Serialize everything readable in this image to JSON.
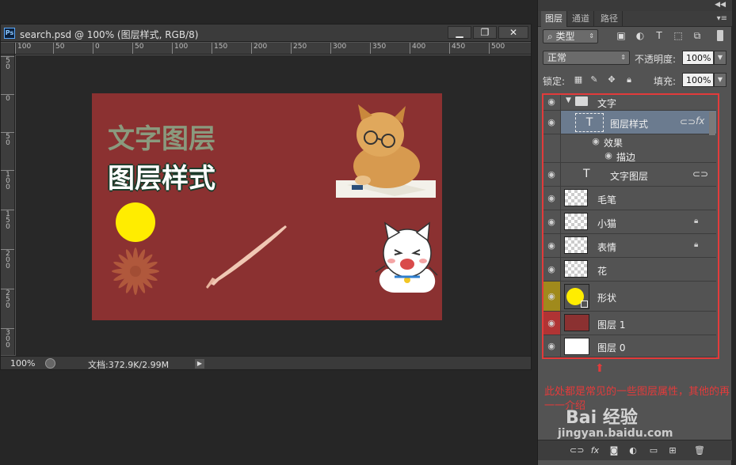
{
  "document": {
    "title": "search.psd @ 100% (图层样式, RGB/8)",
    "ps_logo": "Ps",
    "buttons": {
      "minimize": "▁",
      "restore": "❐",
      "close": "✕"
    },
    "ruler_h": [
      "100",
      "50",
      "0",
      "50",
      "100",
      "150",
      "200",
      "250",
      "300",
      "350",
      "400",
      "450",
      "500"
    ],
    "ruler_v": [
      "5\n0",
      "0",
      "5\n0",
      "1\n0\n0",
      "1\n5\n0",
      "2\n0\n0",
      "2\n5\n0",
      "3\n0\n0"
    ],
    "zoom": "100%",
    "doc_info": "文档:372.9K/2.99M",
    "canvas": {
      "text1": "文字图层",
      "text2": "图层样式",
      "bg_color": "#8b3131",
      "circle_color": "#ffed00"
    }
  },
  "panel": {
    "tabs": [
      {
        "label": "图层",
        "active": true
      },
      {
        "label": "通道",
        "active": false
      },
      {
        "label": "路径",
        "active": false
      }
    ],
    "filter": {
      "label": "类型"
    },
    "blend_mode": "正常",
    "opacity_label": "不透明度:",
    "opacity_value": "100%",
    "lock_label": "锁定:",
    "fill_label": "填充:",
    "fill_value": "100%",
    "layers": [
      {
        "name": "文字",
        "kind": "group"
      },
      {
        "name": "图层样式",
        "kind": "text",
        "selected": true,
        "fx": "fx"
      },
      {
        "name": "效果",
        "kind": "effect"
      },
      {
        "name": "描边",
        "kind": "effect"
      },
      {
        "name": "文字图层",
        "kind": "text"
      },
      {
        "name": "毛笔",
        "kind": "pixel"
      },
      {
        "name": "小猫",
        "kind": "pixel",
        "locked": true
      },
      {
        "name": "表情",
        "kind": "pixel",
        "locked": true
      },
      {
        "name": "花",
        "kind": "pixel"
      },
      {
        "name": "形状",
        "kind": "shape",
        "thumb_color": "#ffed00"
      },
      {
        "name": "图层 1",
        "kind": "pixel",
        "thumb_color": "#8b3131"
      },
      {
        "name": "图层 0",
        "kind": "pixel",
        "thumb_color": "#ffffff"
      }
    ],
    "annotation": "此处都是常见的一些图层属性，其他的再一一介绍",
    "watermark": "Bai 经验",
    "watermark_url": "jingyan.baidu.com",
    "accent_red": "#e23b3b"
  }
}
